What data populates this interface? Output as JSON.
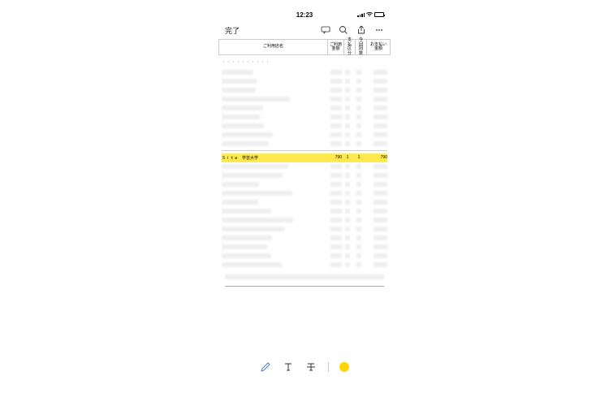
{
  "status": {
    "time": "12:23"
  },
  "toolbar": {
    "done": "完了"
  },
  "table": {
    "headers": {
      "store": "ご利用店名",
      "amount": "ご利用\n金額",
      "type": "支払\n区分",
      "times": "今回\n回数",
      "payAmount": "お支払い金額"
    }
  },
  "highlighted": {
    "store": "Ｓｉｔａ　学芸大学",
    "amount": "790",
    "type": "1",
    "times": "1",
    "payAmount": "790"
  },
  "rowCount": {
    "before": 9,
    "after": 12
  }
}
